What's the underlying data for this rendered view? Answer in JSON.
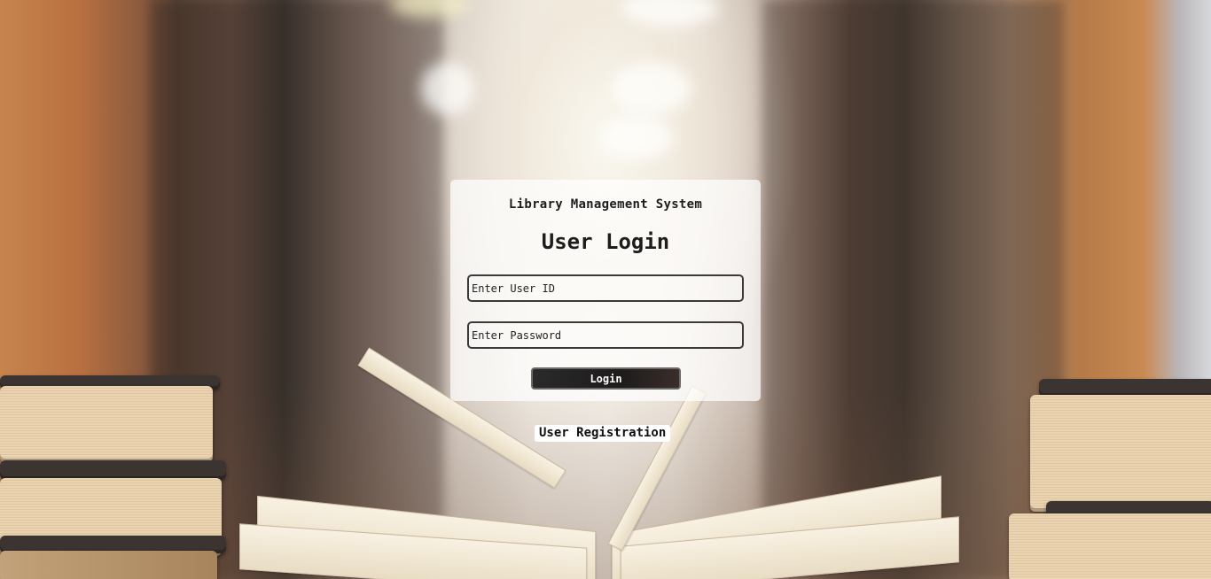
{
  "card": {
    "app_title": "Library Management System",
    "heading": "User Login",
    "user_id": {
      "value": "",
      "placeholder": "Enter User ID"
    },
    "password": {
      "value": "",
      "placeholder": "Enter Password"
    },
    "login_label": "Login"
  },
  "footer": {
    "registration_label": "User Registration"
  },
  "colors": {
    "card_background": "#ffffffb8",
    "button_background": "#1e1b1b",
    "text": "#1d1d1d"
  }
}
